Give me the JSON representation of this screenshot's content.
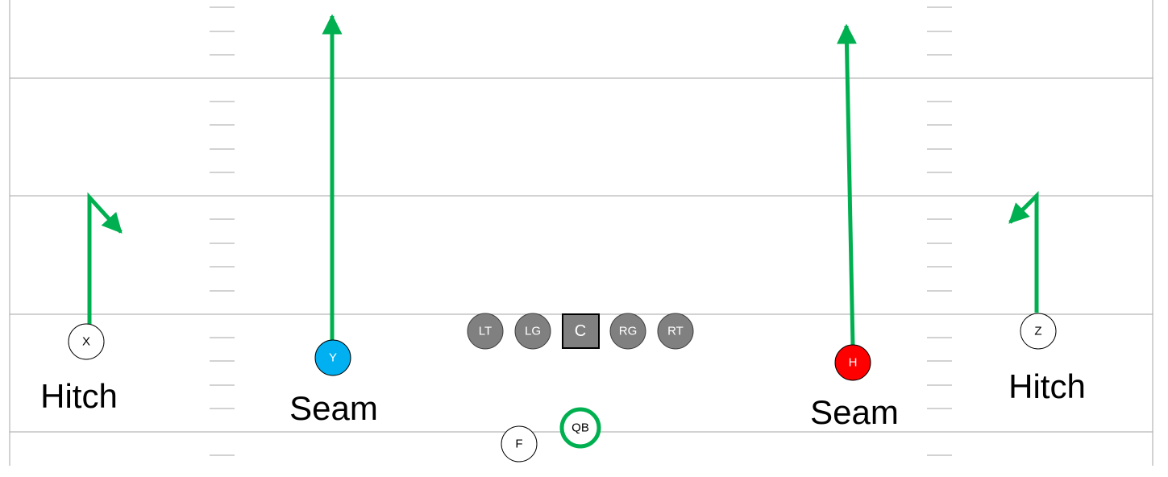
{
  "colors": {
    "route": "#00b050",
    "lineman": "#808080",
    "y_fill": "#00b0f0",
    "h_fill": "#ff0000",
    "line": "#a6a6a6"
  },
  "players": {
    "x": "X",
    "y": "Y",
    "lt": "LT",
    "lg": "LG",
    "c": "C",
    "rg": "RG",
    "rt": "RT",
    "h": "H",
    "z": "Z",
    "qb": "QB",
    "f": "F"
  },
  "routes": {
    "x": "Hitch",
    "y": "Seam",
    "h": "Seam",
    "z": "Hitch"
  }
}
